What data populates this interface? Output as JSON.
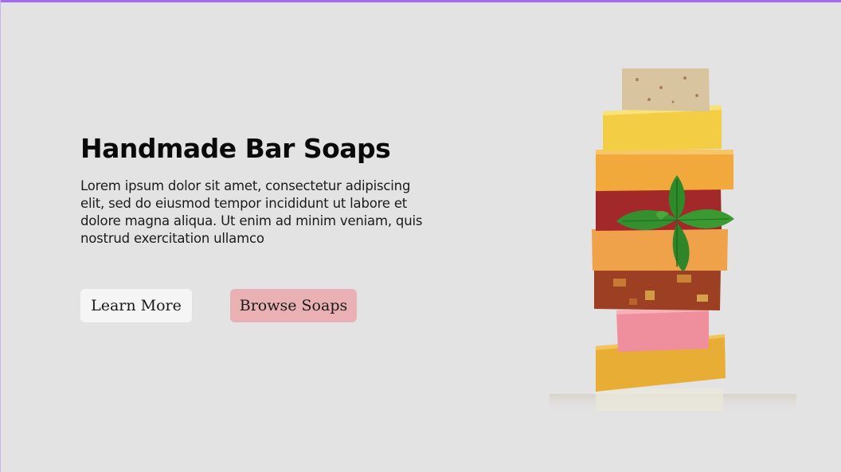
{
  "hero": {
    "title": "Handmade Bar Soaps",
    "description": "Lorem ipsum dolor sit amet, consectetur adipiscing elit, sed do eiusmod tempor incididunt ut labore et dolore magna aliqua. Ut enim ad minim veniam, quis nostrud exercitation ullamco"
  },
  "buttons": {
    "learn_more": "Learn More",
    "browse_soaps": "Browse Soaps"
  },
  "image": {
    "subject": "soap-stack-with-basil",
    "colors": {
      "accent_bar": "#a36cf0",
      "background": "#e3e3e3",
      "browse_button": "#e9b1b4",
      "learn_button": "#f5f5f5"
    }
  }
}
